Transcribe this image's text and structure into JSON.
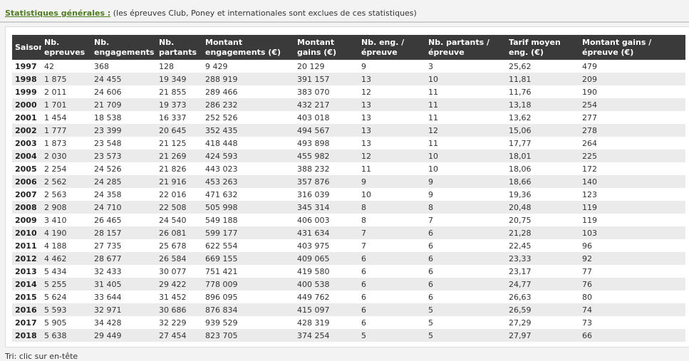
{
  "header": {
    "title": "Statistiques générales :",
    "subtitle": " (les épreuves Club, Poney et internationales sont exclues de ces statistiques)"
  },
  "table": {
    "columns": [
      "Saison",
      "Nb. epreuves",
      "Nb. engagements",
      "Nb. partants",
      "Montant engagements (€)",
      "Montant gains (€)",
      "Nb. eng. / épreuve",
      "Nb. partants / épreuve",
      "Tarif moyen eng. (€)",
      "Montant gains / épreuve (€)"
    ],
    "rows": [
      [
        "1997",
        "42",
        "368",
        "128",
        "9 429",
        "20 129",
        "9",
        "3",
        "25,62",
        "479"
      ],
      [
        "1998",
        "1 875",
        "24 455",
        "19 349",
        "288 919",
        "391 157",
        "13",
        "10",
        "11,81",
        "209"
      ],
      [
        "1999",
        "2 011",
        "24 606",
        "21 855",
        "289 466",
        "383 070",
        "12",
        "11",
        "11,76",
        "190"
      ],
      [
        "2000",
        "1 701",
        "21 709",
        "19 373",
        "286 232",
        "432 217",
        "13",
        "11",
        "13,18",
        "254"
      ],
      [
        "2001",
        "1 454",
        "18 538",
        "16 337",
        "252 526",
        "403 018",
        "13",
        "11",
        "13,62",
        "277"
      ],
      [
        "2002",
        "1 777",
        "23 399",
        "20 645",
        "352 435",
        "494 567",
        "13",
        "12",
        "15,06",
        "278"
      ],
      [
        "2003",
        "1 873",
        "23 548",
        "21 125",
        "418 448",
        "493 898",
        "13",
        "11",
        "17,77",
        "264"
      ],
      [
        "2004",
        "2 030",
        "23 573",
        "21 269",
        "424 593",
        "455 982",
        "12",
        "10",
        "18,01",
        "225"
      ],
      [
        "2005",
        "2 254",
        "24 526",
        "21 826",
        "443 023",
        "388 232",
        "11",
        "10",
        "18,06",
        "172"
      ],
      [
        "2006",
        "2 562",
        "24 285",
        "21 916",
        "453 263",
        "357 876",
        "9",
        "9",
        "18,66",
        "140"
      ],
      [
        "2007",
        "2 563",
        "24 358",
        "22 016",
        "471 632",
        "316 039",
        "10",
        "9",
        "19,36",
        "123"
      ],
      [
        "2008",
        "2 908",
        "24 710",
        "22 508",
        "505 998",
        "345 314",
        "8",
        "8",
        "20,48",
        "119"
      ],
      [
        "2009",
        "3 410",
        "26 465",
        "24 540",
        "549 188",
        "406 003",
        "8",
        "7",
        "20,75",
        "119"
      ],
      [
        "2010",
        "4 190",
        "28 157",
        "26 081",
        "599 177",
        "431 634",
        "7",
        "6",
        "21,28",
        "103"
      ],
      [
        "2011",
        "4 188",
        "27 735",
        "25 678",
        "622 554",
        "403 975",
        "7",
        "6",
        "22,45",
        "96"
      ],
      [
        "2012",
        "4 462",
        "28 677",
        "26 584",
        "669 155",
        "409 065",
        "6",
        "6",
        "23,33",
        "92"
      ],
      [
        "2013",
        "5 434",
        "32 433",
        "30 077",
        "751 421",
        "419 580",
        "6",
        "6",
        "23,17",
        "77"
      ],
      [
        "2014",
        "5 255",
        "31 405",
        "29 422",
        "778 009",
        "400 538",
        "6",
        "6",
        "24,77",
        "76"
      ],
      [
        "2015",
        "5 624",
        "33 644",
        "31 452",
        "896 095",
        "449 762",
        "6",
        "6",
        "26,63",
        "80"
      ],
      [
        "2016",
        "5 593",
        "32 971",
        "30 686",
        "876 834",
        "415 097",
        "6",
        "5",
        "26,59",
        "74"
      ],
      [
        "2017",
        "5 905",
        "34 428",
        "32 229",
        "939 529",
        "428 319",
        "6",
        "5",
        "27,29",
        "73"
      ],
      [
        "2018",
        "5 638",
        "29 449",
        "27 454",
        "823 705",
        "374 254",
        "5",
        "5",
        "27,97",
        "66"
      ]
    ]
  },
  "footer": {
    "text": "Tri: clic sur en-tête"
  },
  "colors": {
    "title": "#4e7d1e",
    "header_bg": "#3a3a3a",
    "row_alt": "#ebebeb",
    "page_bg": "#f3f3f3"
  }
}
